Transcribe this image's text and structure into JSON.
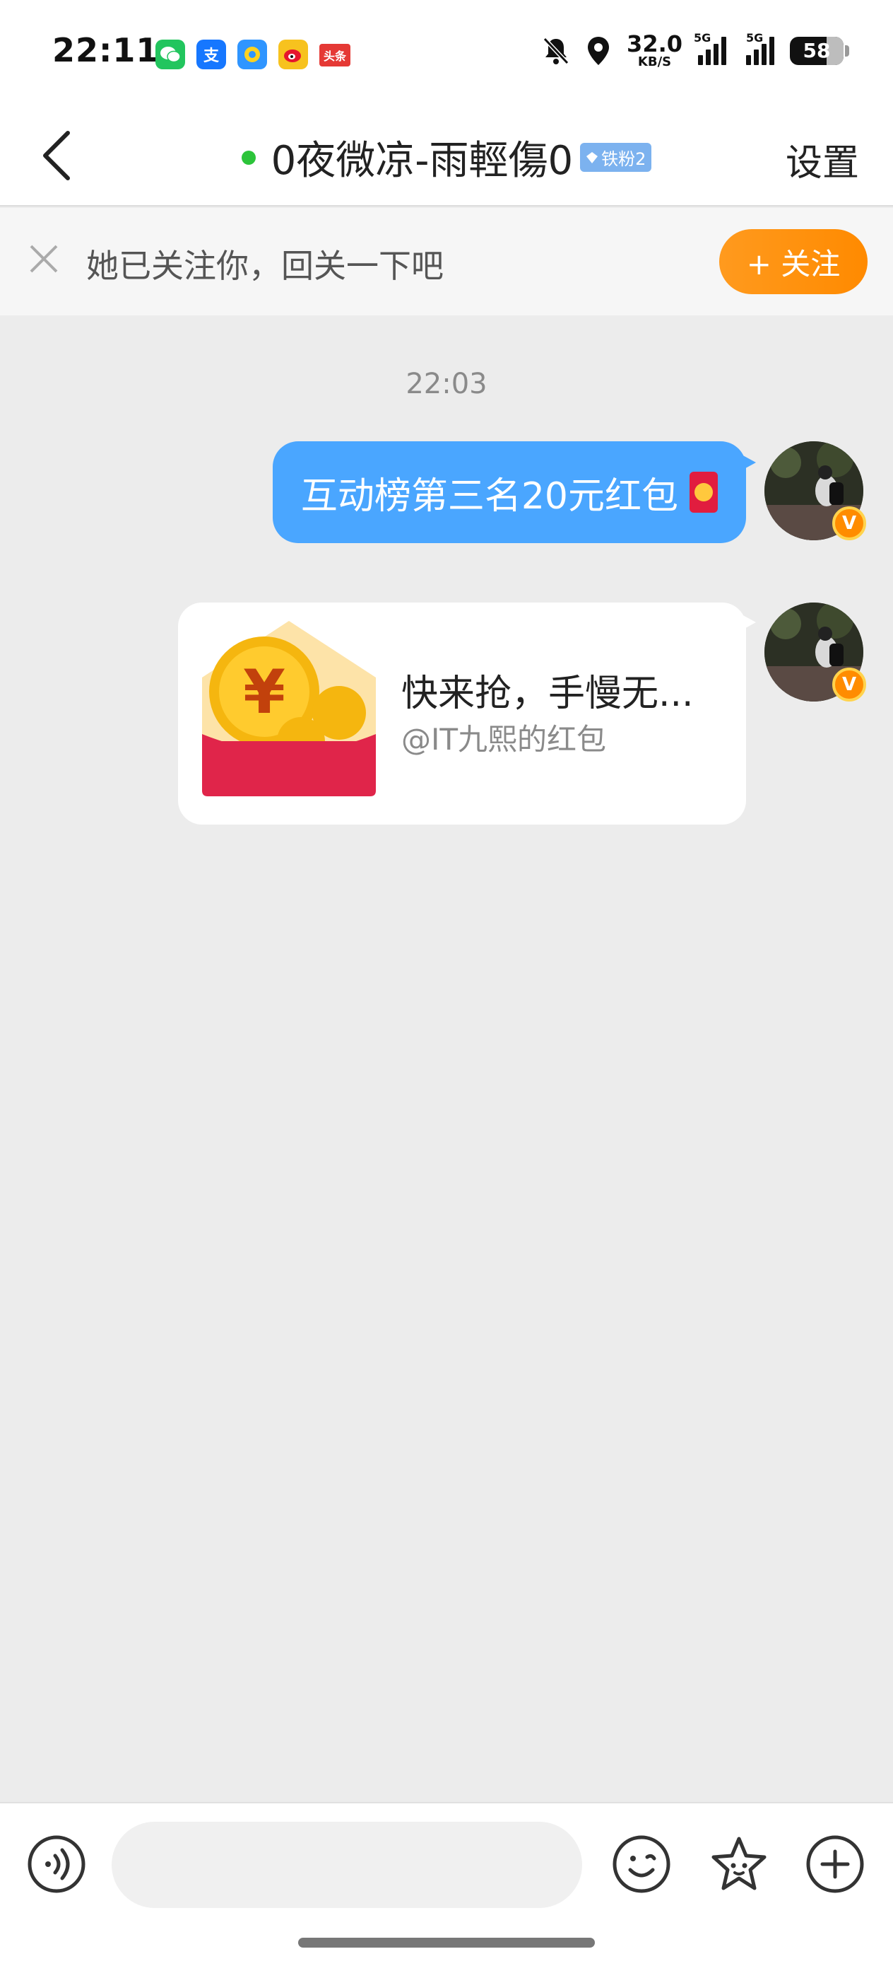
{
  "status_bar": {
    "time": "22:11",
    "notif_apps": [
      {
        "icon": "wechat-icon",
        "glyph": "✆",
        "color": "#22c55e"
      },
      {
        "icon": "alipay-icon",
        "glyph": "支",
        "color": "#1677ff"
      },
      {
        "icon": "qq-browser-icon",
        "glyph": "Q",
        "color": "#2f95ff"
      },
      {
        "icon": "weibo-icon",
        "glyph": "微",
        "color": "#f7c21e"
      },
      {
        "icon": "toutiao-icon",
        "glyph": "头条",
        "color": "#e53935"
      }
    ],
    "net_speed_value": "32.0",
    "net_speed_unit": "KB/S",
    "sim1_label": "5G",
    "sim2_label": "5G",
    "battery": "58"
  },
  "header": {
    "title": "0夜微凉-雨輕傷0",
    "fan_badge": "铁粉2",
    "settings_label": "设置",
    "online_color": "#2cc43a"
  },
  "follow_banner": {
    "text": "她已关注你，回关一下吧",
    "follow_button": "+ 关注"
  },
  "chat": {
    "timestamp": "22:03",
    "messages": [
      {
        "type": "text",
        "text": "互动榜第三名20元红包"
      },
      {
        "type": "red_packet",
        "title": "快来抢，手慢无...",
        "subtitle": "@IT九熙的红包"
      }
    ]
  },
  "input_bar": {
    "placeholder": ""
  },
  "colors": {
    "bubble": "#4aa6ff",
    "follow": "#ff8a00",
    "background": "#ececec"
  }
}
